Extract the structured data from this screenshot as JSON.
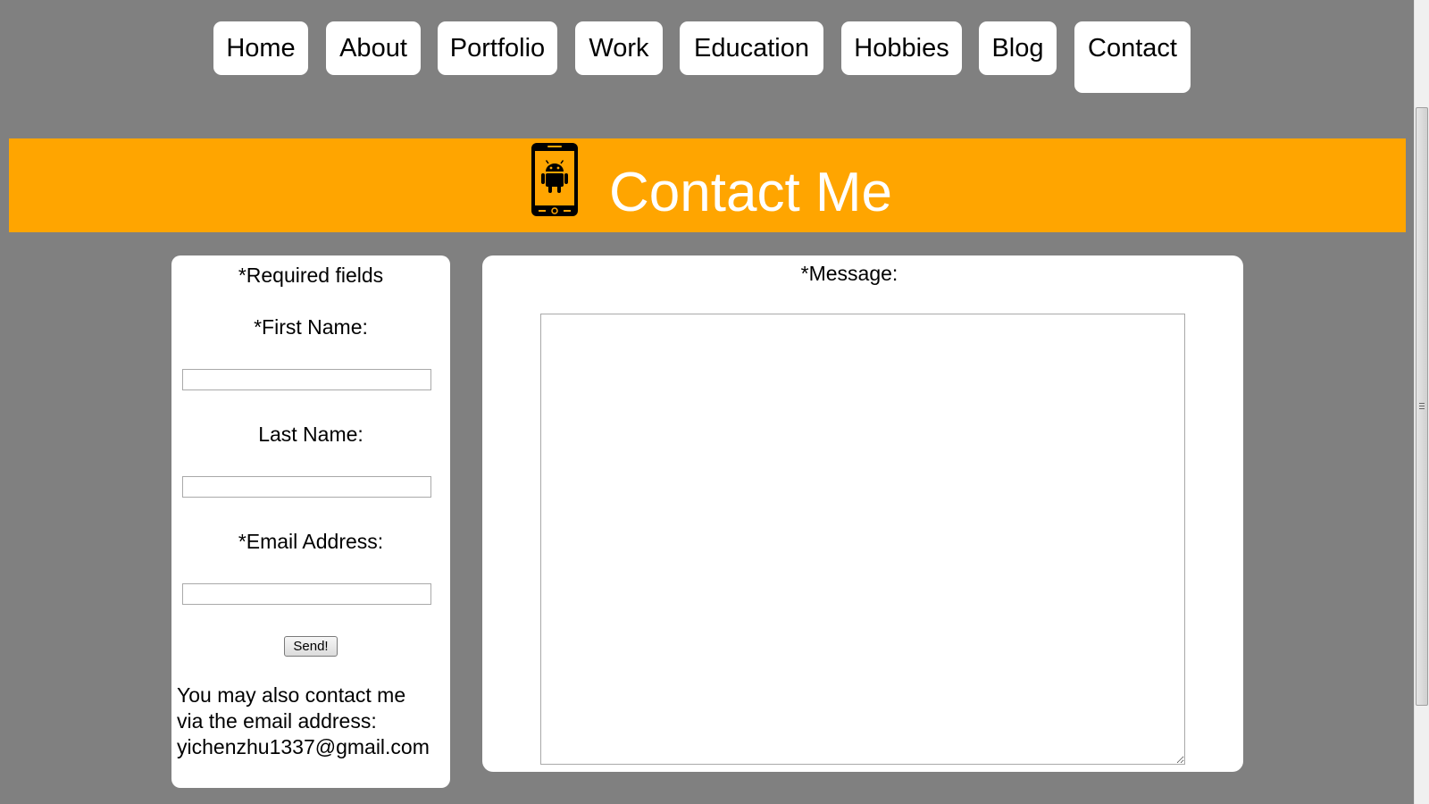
{
  "nav": {
    "items": [
      {
        "label": "Home"
      },
      {
        "label": "About"
      },
      {
        "label": "Portfolio"
      },
      {
        "label": "Work"
      },
      {
        "label": "Education"
      },
      {
        "label": "Hobbies"
      },
      {
        "label": "Blog"
      },
      {
        "label": "Contact",
        "active": true
      }
    ]
  },
  "banner": {
    "icon": "android-phone-icon",
    "title": "Contact Me",
    "color": "#ffa500"
  },
  "form": {
    "required_note": "*Required fields",
    "first_name_label": "*First Name:",
    "first_name_value": "",
    "last_name_label": "Last Name:",
    "last_name_value": "",
    "email_label": "*Email Address:",
    "email_value": "",
    "send_label": "Send!",
    "message_label": "*Message:",
    "message_value": ""
  },
  "contact_note": {
    "line1": "You may also contact me",
    "line2": "via the email address:",
    "email": "yichenzhu1337@gmail.com"
  }
}
